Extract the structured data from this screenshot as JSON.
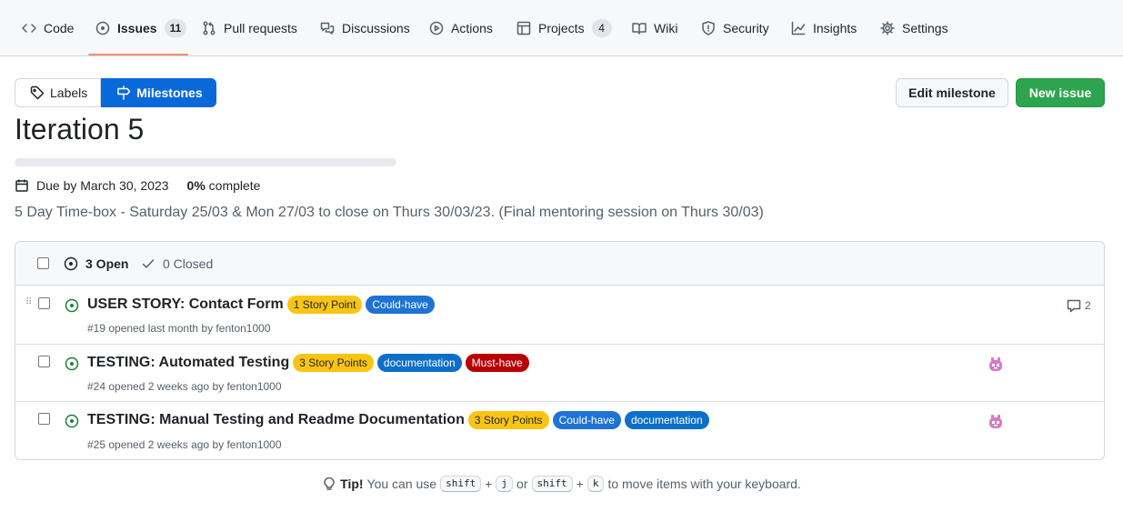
{
  "repo_nav": {
    "tabs": [
      {
        "label": "Code",
        "icon": "code-icon"
      },
      {
        "label": "Issues",
        "icon": "issue-opened-icon",
        "counter": "11",
        "selected": true
      },
      {
        "label": "Pull requests",
        "icon": "git-pull-request-icon"
      },
      {
        "label": "Discussions",
        "icon": "comment-discussion-icon"
      },
      {
        "label": "Actions",
        "icon": "play-icon"
      },
      {
        "label": "Projects",
        "icon": "table-icon",
        "counter": "4"
      },
      {
        "label": "Wiki",
        "icon": "book-icon"
      },
      {
        "label": "Security",
        "icon": "shield-icon"
      },
      {
        "label": "Insights",
        "icon": "graph-icon"
      },
      {
        "label": "Settings",
        "icon": "gear-icon"
      }
    ]
  },
  "subnav": {
    "labels": "Labels",
    "milestones": "Milestones"
  },
  "actions": {
    "edit_milestone": "Edit milestone",
    "new_issue": "New issue"
  },
  "milestone": {
    "title": "Iteration 5",
    "progress": 0,
    "due": "Due by March 30, 2023",
    "percent": "0%",
    "complete_text": "complete",
    "description": "5 Day Time-box - Saturday 25/03 & Mon 27/03 to close on Thurs 30/03/23. (Final mentoring session on Thurs 30/03)"
  },
  "issues_header": {
    "open": "3 Open",
    "closed": "0 Closed"
  },
  "issues": [
    {
      "title": "USER STORY: Contact Form",
      "labels": [
        {
          "text": "1 Story Point",
          "bg": "#f9c513",
          "fg": "#1f2328"
        },
        {
          "text": "Could-have",
          "bg": "#1f73d2",
          "fg": "#ffffff"
        }
      ],
      "meta": "#19 opened last month by fenton1000",
      "comments": "2"
    },
    {
      "title": "TESTING: Automated Testing",
      "labels": [
        {
          "text": "3 Story Points",
          "bg": "#f9c513",
          "fg": "#1f2328"
        },
        {
          "text": "documentation",
          "bg": "#0e6fc8",
          "fg": "#ffffff"
        },
        {
          "text": "Must-have",
          "bg": "#b60205",
          "fg": "#ffffff"
        }
      ],
      "meta": "#24 opened 2 weeks ago by fenton1000",
      "avatar": "assignee-avatar-icon"
    },
    {
      "title": "TESTING: Manual Testing and Readme Documentation",
      "labels": [
        {
          "text": "3 Story Points",
          "bg": "#f9c513",
          "fg": "#1f2328"
        },
        {
          "text": "Could-have",
          "bg": "#1f73d2",
          "fg": "#ffffff"
        },
        {
          "text": "documentation",
          "bg": "#0e6fc8",
          "fg": "#ffffff"
        }
      ],
      "meta": "#25 opened 2 weeks ago by fenton1000",
      "avatar": "assignee-avatar-icon"
    }
  ],
  "tip": {
    "bold": "Tip!",
    "text1": "You can use",
    "key_shift": "shift",
    "plus": "+",
    "key_j": "j",
    "or": "or",
    "key_k": "k",
    "text2": "to move items with your keyboard."
  },
  "colors": {
    "accent": "#0969da",
    "success": "#2da44e",
    "open_issue": "#1a7f37",
    "avatar": "#d978c8"
  }
}
